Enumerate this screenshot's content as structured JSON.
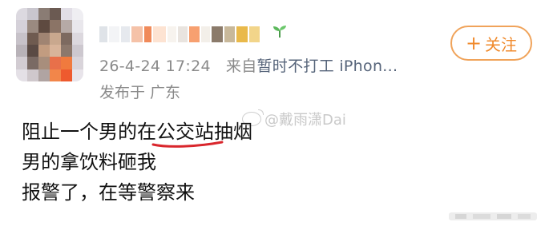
{
  "post": {
    "timestamp": "26-4-24 17:24",
    "source_prefix": "来自",
    "source_name": "暂时不打工 iPhon...",
    "location": "发布于 广东",
    "follow_label": "关注",
    "follow_icon": "plus-icon",
    "watermark_text": "@戴雨潇Dai",
    "watermark_icon": "weibo-logo-icon",
    "text_lines": [
      "阻止一个男的在",
      "公交站",
      "抽烟",
      "男的拿饮料砸我",
      "报警了，在等警察来"
    ],
    "highlight_color": "#d9262c",
    "accent_color": "#f08a2c"
  }
}
